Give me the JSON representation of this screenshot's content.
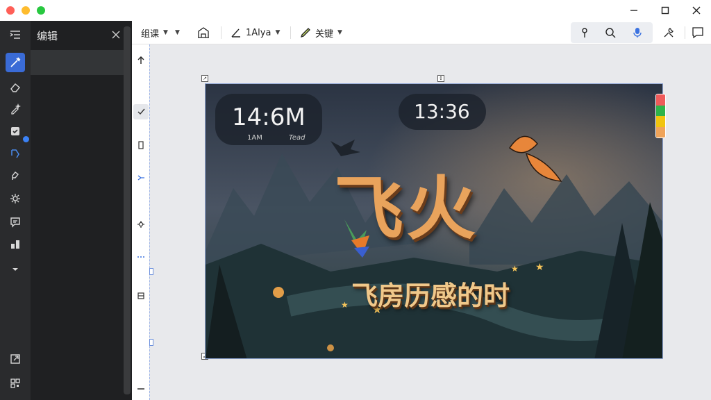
{
  "window": {
    "controls": [
      "close",
      "minimize",
      "maximize"
    ],
    "right_controls": [
      "minimize-icon",
      "maximize-icon",
      "close-icon"
    ]
  },
  "rail": {
    "icons": [
      "list-collapse-icon",
      "magic-brush-icon",
      "eraser-icon",
      "pen-sparkle-icon",
      "checkbox-icon",
      "lasso-icon",
      "pen-tool-icon",
      "gear-sparkle-icon",
      "comment-icon",
      "layers-icon",
      "chevron-down-icon",
      "export-icon",
      "qr-code-icon"
    ],
    "active": "magic-brush-icon"
  },
  "panel": {
    "title": "编辑"
  },
  "toolbar": {
    "group_label": "组课",
    "font_label": "1Alya",
    "brush_label": "关键",
    "icons": [
      "home-icon",
      "pin-icon",
      "search-icon",
      "mic-icon",
      "tools-icon",
      "chat-icon"
    ]
  },
  "poster": {
    "clock_left": "14:6M",
    "clock_left_sub1": "1AM",
    "clock_left_sub2": "Tead",
    "clock_top": "13:36",
    "headline": "飞火",
    "subhead": "飞房历感的时"
  },
  "colors": {
    "rail_bg": "#2a2b2d",
    "panel_bg": "#1f2022",
    "accent": "#3a6bd6",
    "swatches": [
      "#ef5b5b",
      "#2fb34a",
      "#f1c40f",
      "#f0a45a"
    ]
  }
}
